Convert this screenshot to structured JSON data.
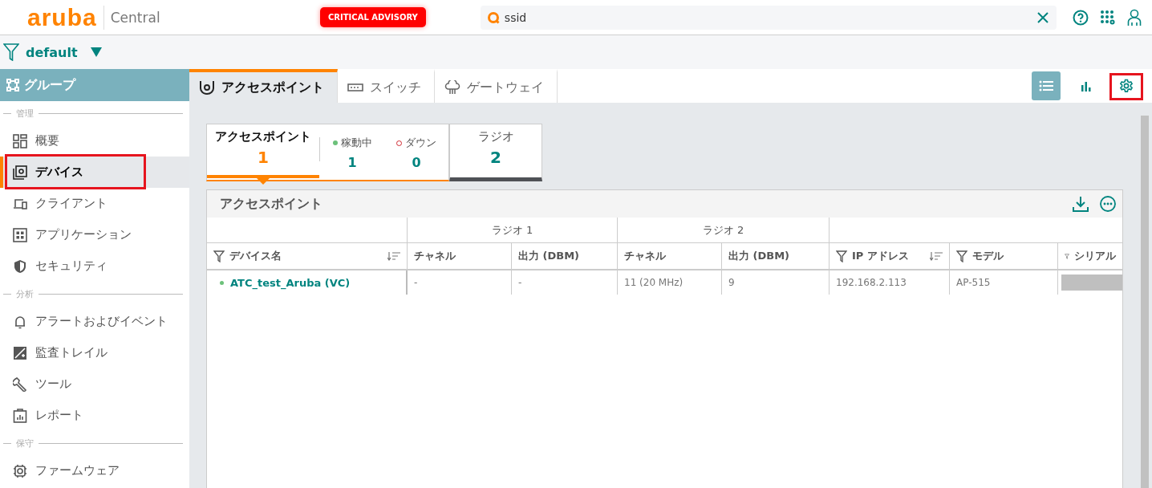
{
  "header": {
    "logo": "aruba",
    "product": "Central",
    "advisory": "CRITICAL ADVISORY",
    "search": {
      "value": "ssid"
    }
  },
  "filter": {
    "label": "default"
  },
  "sidebar": {
    "title": "グループ",
    "sections": [
      {
        "heading": "管理",
        "items": [
          {
            "label": "概要",
            "selected": false
          },
          {
            "label": "デバイス",
            "selected": true,
            "annotated": true
          },
          {
            "label": "クライアント",
            "selected": false
          },
          {
            "label": "アプリケーション",
            "selected": false
          },
          {
            "label": "セキュリティ",
            "selected": false
          }
        ]
      },
      {
        "heading": "分析",
        "items": [
          {
            "label": "アラートおよびイベント",
            "selected": false
          },
          {
            "label": "監査トレイル",
            "selected": false
          },
          {
            "label": "ツール",
            "selected": false
          },
          {
            "label": "レポート",
            "selected": false
          }
        ]
      },
      {
        "heading": "保守",
        "items": [
          {
            "label": "ファームウェア",
            "selected": false
          }
        ]
      }
    ]
  },
  "tabs": [
    {
      "label": "アクセスポイント",
      "selected": true
    },
    {
      "label": "スイッチ",
      "selected": false
    },
    {
      "label": "ゲートウェイ",
      "selected": false
    }
  ],
  "view_tools": [
    {
      "selected": true
    },
    {
      "selected": false
    },
    {
      "selected": false,
      "annotated": true
    }
  ],
  "summary": [
    {
      "label": "アクセスポイント",
      "count": "1",
      "selected": true,
      "stats": [
        {
          "kind": "up",
          "label": "稼動中",
          "count": "1"
        },
        {
          "kind": "down",
          "label": "ダウン",
          "count": "0"
        }
      ]
    },
    {
      "label": "ラジオ",
      "count": "2",
      "selected": false
    }
  ],
  "table": {
    "title": "アクセスポイント",
    "groups": [
      "ラジオ 1",
      "ラジオ 2"
    ],
    "columns": [
      {
        "label": "デバイス名",
        "filter": true,
        "sort": true
      },
      {
        "label": "チャネル",
        "filter": false,
        "sort": false
      },
      {
        "label": "出力 (DBM)",
        "filter": false,
        "sort": false
      },
      {
        "label": "チャネル",
        "filter": false,
        "sort": false
      },
      {
        "label": "出力 (DBM)",
        "filter": false,
        "sort": false
      },
      {
        "label": "IP アドレス",
        "filter": true,
        "sort": true
      },
      {
        "label": "モデル",
        "filter": true,
        "sort": false
      },
      {
        "label": "シリアル",
        "filter": true,
        "sort": false
      }
    ],
    "rows": [
      {
        "online": true,
        "cells": [
          "ATC_test_Aruba (VC)",
          "-",
          "-",
          "11 (20 MHz)",
          "9",
          "192.168.2.113",
          "AP-515"
        ],
        "serial_redacted": true
      }
    ]
  }
}
